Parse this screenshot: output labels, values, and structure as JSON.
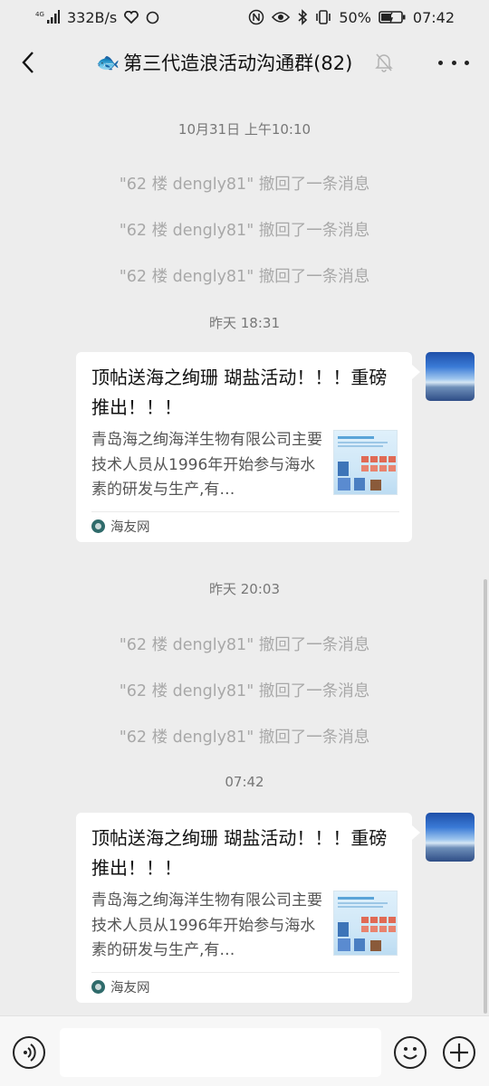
{
  "statusbar": {
    "signal": "4G",
    "speed": "332B/s",
    "battery": "50%",
    "time": "07:42"
  },
  "header": {
    "title": "第三代造浪活动沟通群(82)"
  },
  "messages": [
    {
      "type": "time",
      "text": "10月31日 上午10:10"
    },
    {
      "type": "system",
      "text": "\"62 楼 dengly81\" 撤回了一条消息"
    },
    {
      "type": "system",
      "text": "\"62 楼 dengly81\" 撤回了一条消息"
    },
    {
      "type": "system",
      "text": "\"62 楼 dengly81\" 撤回了一条消息"
    },
    {
      "type": "time",
      "text": "昨天 18:31"
    },
    {
      "type": "link-card",
      "title": "顶帖送海之绚珊 瑚盐活动！！！重磅推出！！！",
      "description": "青岛海之绚海洋生物有限公司主要技术人员从1996年开始参与海水素的研发与生产,有…",
      "source": "海友网"
    },
    {
      "type": "time",
      "text": "昨天 20:03"
    },
    {
      "type": "system",
      "text": "\"62 楼 dengly81\" 撤回了一条消息"
    },
    {
      "type": "system",
      "text": "\"62 楼 dengly81\" 撤回了一条消息"
    },
    {
      "type": "system",
      "text": "\"62 楼 dengly81\" 撤回了一条消息"
    },
    {
      "type": "time",
      "text": "07:42"
    },
    {
      "type": "link-card",
      "title": "顶帖送海之绚珊 瑚盐活动！！！重磅推出！！！",
      "description": "青岛海之绚海洋生物有限公司主要技术人员从1996年开始参与海水素的研发与生产,有…",
      "source": "海友网"
    }
  ],
  "input": {
    "placeholder": ""
  },
  "icons": {
    "back": "chevron-left-icon",
    "mute": "bell-off-icon",
    "more": "more-dots-icon",
    "voice": "voice-icon",
    "emoji": "emoji-icon",
    "plus": "plus-icon"
  }
}
